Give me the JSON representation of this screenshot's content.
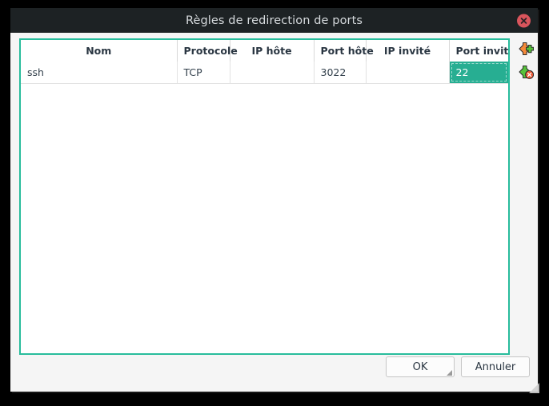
{
  "window": {
    "title": "Règles de redirection de ports",
    "close_icon": "close-icon",
    "accent_color": "#28bc9c",
    "titlebar_color": "#1d2224",
    "close_button_color": "#d9555c",
    "selection_color": "#27ae92"
  },
  "table": {
    "columns": [
      {
        "key": "name",
        "label": "Nom"
      },
      {
        "key": "protocol",
        "label": "Protocole"
      },
      {
        "key": "host_ip",
        "label": "IP hôte"
      },
      {
        "key": "host_port",
        "label": "Port hôte"
      },
      {
        "key": "guest_ip",
        "label": "IP invité"
      },
      {
        "key": "guest_port",
        "label": "Port invité"
      }
    ],
    "rows": [
      {
        "name": "ssh",
        "protocol": "TCP",
        "host_ip": "",
        "host_port": "3022",
        "guest_ip": "",
        "guest_port": "22"
      }
    ],
    "selected_cell": {
      "row": 0,
      "column": "guest_port",
      "value": "22"
    }
  },
  "tools": {
    "add": {
      "name": "add-rule-icon",
      "tooltip": ""
    },
    "remove": {
      "name": "remove-rule-icon",
      "tooltip": ""
    }
  },
  "footer": {
    "ok_label": "OK",
    "cancel_label": "Annuler"
  }
}
